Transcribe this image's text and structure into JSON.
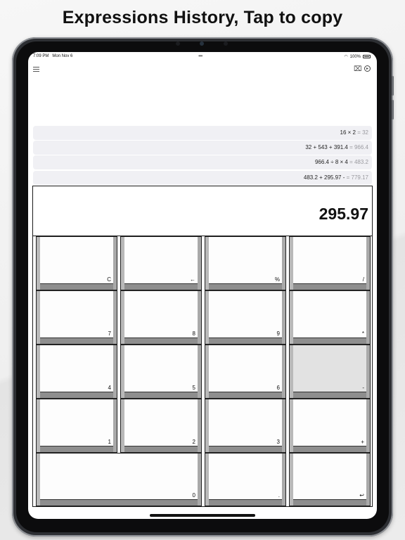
{
  "headline": "Expressions History, Tap to copy",
  "status_bar": {
    "time": "7:09 PM",
    "date": "Mon Nov 6",
    "battery": "100%"
  },
  "toolbar": {
    "menu_icon": "list-menu-icon",
    "clear_icon": "broom-icon",
    "run_icon": "play-circle-icon"
  },
  "history": [
    {
      "expression": "16 × 2",
      "result": "= 32"
    },
    {
      "expression": "32 + 543 + 391.4",
      "result": "= 966.4"
    },
    {
      "expression": "966.4 ÷ 8 × 4",
      "result": "= 483.2"
    },
    {
      "expression": "483.2 + 295.97 -",
      "result": "= 779.17"
    }
  ],
  "display": {
    "value": "295.97"
  },
  "keys": {
    "clear": "C",
    "backspace": "←",
    "percent": "%",
    "divide": "/",
    "seven": "7",
    "eight": "8",
    "nine": "9",
    "multiply": "*",
    "four": "4",
    "five": "5",
    "six": "6",
    "minus": "-",
    "one": "1",
    "two": "2",
    "three": "3",
    "plus": "+",
    "zero": "0",
    "decimal": ".",
    "enter": "↩"
  },
  "colors": {
    "history_bg": "#f0f0f4",
    "history_result": "#9a9a9f",
    "selected_key": "#e2e2e2"
  }
}
